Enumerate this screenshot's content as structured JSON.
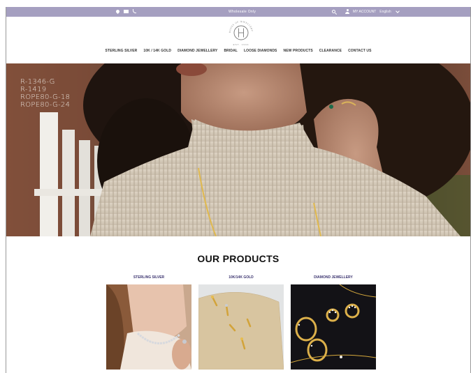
{
  "topbar": {
    "icons": [
      "location-pin-icon",
      "mail-icon",
      "phone-icon"
    ],
    "wholesale_label": "Wholesale Only",
    "search_icon": "search-icon",
    "account_label": "MY ACCOUNT",
    "language_label": "English",
    "bg_color": "#a59fc0"
  },
  "logo": {
    "ring_text": "HOUSE OF JEWELLERY",
    "caption": "EST. 1994"
  },
  "nav": {
    "items": [
      {
        "label": "STERLING SILVER"
      },
      {
        "label": "10K / 14K GOLD"
      },
      {
        "label": "DIAMOND JEWELLERY"
      },
      {
        "label": "BRIDAL"
      },
      {
        "label": "LOOSE DIAMONDS"
      },
      {
        "label": "NEW PRODUCTS"
      },
      {
        "label": "CLEARANCE"
      },
      {
        "label": "CONTACT US"
      }
    ]
  },
  "hero": {
    "product_codes": [
      "R-1346-G",
      "R-1419",
      "ROPE80-G-18",
      "ROPE80-G-24"
    ]
  },
  "products": {
    "title": "OUR PRODUCTS",
    "categories": [
      {
        "label": "STERLING SILVER"
      },
      {
        "label": "10K/14K GOLD"
      },
      {
        "label": "DIAMOND JEWELLERY"
      }
    ]
  }
}
